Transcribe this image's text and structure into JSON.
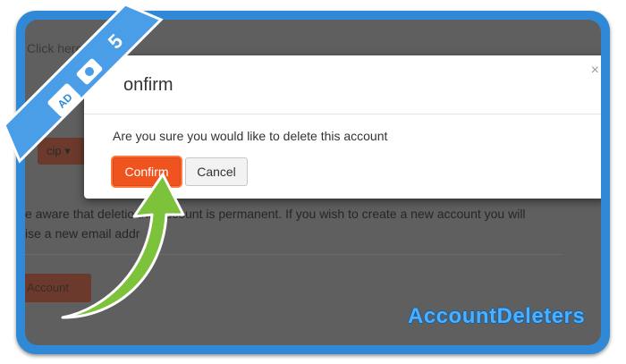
{
  "background": {
    "click_text": "Click here to",
    "dropdown_label": "cip",
    "warning_text": "e aware that deletio    the account is permanent. If you wish to create a new account you will",
    "warning_text2": "ise a new email addr",
    "account_button": "Account"
  },
  "modal": {
    "title": "onfirm",
    "close": "×",
    "message": "Are you sure you would like to delete this account",
    "confirm_label": "Confirm",
    "cancel_label": "Cancel"
  },
  "ribbon": {
    "step_number": "5",
    "badge_text": "AD"
  },
  "brand": "AccountDeleters",
  "colors": {
    "frame": "#2f89d6",
    "confirm": "#f0541e",
    "arrow": "#7cc23a",
    "overlay": "#5f5f5f"
  }
}
